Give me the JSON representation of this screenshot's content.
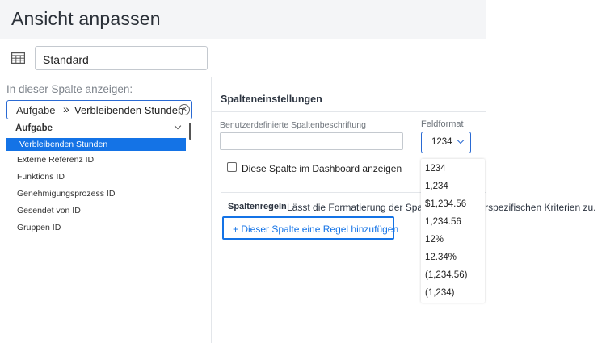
{
  "page": {
    "title": "Ansicht anpassen"
  },
  "view": {
    "name": "Standard",
    "icon": "table-icon"
  },
  "left_panel": {
    "label": "In dieser Spalte anzeigen:",
    "field_path": {
      "parent": "Aufgabe",
      "separator": "»",
      "field": "Verbleibenden Stunden"
    },
    "dropdown": {
      "group": "Aufgabe",
      "items": [
        "Verbleibenden Stunden",
        "Externe Referenz ID",
        "Funktions ID",
        "Genehmigungsprozess ID",
        "Gesendet von ID",
        "Gruppen ID"
      ],
      "selected": "Verbleibenden Stunden"
    }
  },
  "column_settings": {
    "title": "Spalteneinstellungen",
    "custom_label": "Benutzerdefinierte Spaltenbeschriftung",
    "custom_value": "",
    "field_format_label": "Feldformat",
    "field_format_value": "1234",
    "dashboard_checkbox_label": "Diese Spalte im Dashboard anzeigen",
    "dashboard_checked": false,
    "rules_title": "Spaltenregeln",
    "rules_description": "Lässt die Formatierung der Spa",
    "rules_description_tail": "rspezifischen Kriterien zu.",
    "add_rule_button": "+ Dieser Spalte eine Regel hinzufügen"
  },
  "format_options": [
    "1234",
    "1,234",
    "$1,234.56",
    "1,234.56",
    "12%",
    "12.34%",
    "(1,234.56)",
    "(1,234)"
  ],
  "colors": {
    "accent": "#1473e6",
    "header_bg": "#f4f5f7"
  }
}
